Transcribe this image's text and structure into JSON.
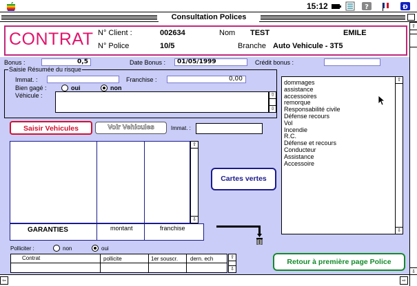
{
  "menubar": {
    "clock": "15:12",
    "icons": [
      "apple-logo-icon",
      "battery-icon",
      "app-menu-icon",
      "help-icon",
      "flag-icon",
      "application-icon"
    ]
  },
  "window": {
    "title": "Consultation Polices"
  },
  "header": {
    "title": "CONTRAT",
    "client_label": "N° Client :",
    "client_value": "002634",
    "police_label": "N° Police",
    "police_value": "10/5",
    "nom_label": "Nom",
    "nom_value": "TEST",
    "prenom_value": "EMILE",
    "branche_label": "Branche",
    "branche_value": "Auto Vehicule - 3T5"
  },
  "bonus": {
    "bonus_label": "Bonus :",
    "bonus_value": "0,5",
    "date_label": "Date Bonus :",
    "date_value": "01/05/1999",
    "credit_label": "Crédit bonus :",
    "credit_value": ""
  },
  "risque": {
    "group_label": "Saisie Résumée du risque",
    "immat_label": "Immat. :",
    "immat_value": "",
    "franchise_label": "Franchise :",
    "franchise_value": "0,00",
    "gage_label": "Bien gagé :",
    "oui_label": "oui",
    "non_label": "non",
    "vehicule_label": "Véhicule :",
    "vehicule_value": ""
  },
  "risk_types": [
    "dommages",
    "assistance",
    "accessoires",
    "remorque",
    "Responsabilité civile",
    "Défense recours",
    "Vol",
    "Incendie",
    "R.C.",
    "Défense et recours",
    "Conducteur",
    "Assistance",
    "Accessoire"
  ],
  "vehicles": {
    "saisir_label": "Saisir Vehicules",
    "voir_label": "Voir Vehicules",
    "immat_label": "Immat. :",
    "immat_value": ""
  },
  "garanties": {
    "col1": "GARANTIES",
    "col2": "montant",
    "col3": "franchise"
  },
  "cartes_label": "Cartes vertes",
  "polliciter": {
    "label": "Polliciter :",
    "non_label": "non",
    "oui_label": "oui"
  },
  "contract_table": {
    "headers": [
      "Contrat",
      "pollicite",
      "1er souscr.",
      "dern. ech"
    ]
  },
  "retour_label": "Retour à première page Police",
  "colors": {
    "magenta": "#e0156c",
    "red": "#d01030",
    "panel": "#c9cdf7",
    "button_blue": "#1a1a8c",
    "green": "#138a2a"
  }
}
